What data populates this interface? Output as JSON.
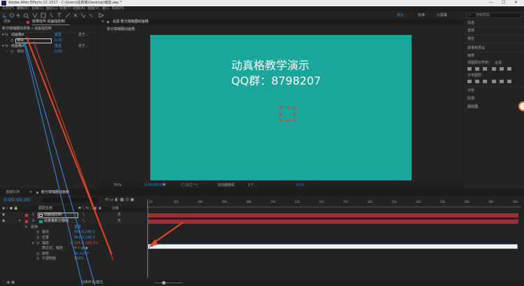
{
  "titlebar": {
    "title": "Adobe After Effects CC 2017 - C:\\Users\\动真格\\Desktop\\缩放.aep *"
  },
  "menu": [
    "文件(F)",
    "编辑(E)",
    "合成(C)",
    "图层(L)",
    "效果(T)",
    "动画(A)",
    "视图(V)",
    "窗口",
    "帮助(H)"
  ],
  "workspaces": [
    "默认",
    "标准",
    "小屏幕"
  ],
  "search_help_placeholder": "搜索帮助",
  "left_panel": {
    "tabs": [
      "项目",
      "效果控件 动画指控制"
    ],
    "breadcrumb": "新分镜缩圈动漫格 • 动画指控制",
    "rows": [
      {
        "name": "动画格A",
        "reset": "重置",
        "about": "关于..."
      },
      {
        "name": "滑块",
        "value": "0.00"
      },
      {
        "name": "动画格A",
        "reset": "重置",
        "about": "关于..."
      },
      {
        "name": "滑块",
        "value": "0.00"
      }
    ]
  },
  "comp_panel": {
    "tab": "合成 新分镜缩圈动画格",
    "sub_tab": "新分镜缩圈动画格",
    "overlay_line1": "动真格教学演示",
    "overlay_line2": "QQ群：8798207",
    "bg_color": "#1aa69a",
    "footer": {
      "zoom": "55%",
      "time": "0:00:00:00",
      "quality": "(二分之一)",
      "view": "活动摄像机",
      "views_count": "1个...",
      "exposure": "+0.0"
    }
  },
  "right_panel": {
    "items": [
      "信息",
      "音频",
      "预览",
      "效果和预设",
      "对齐",
      "字符",
      "段落",
      "跟踪器"
    ],
    "align_label": "将图层对齐到：",
    "align_value": "合成",
    "distribute_label": "分布图层："
  },
  "timeline": {
    "tabs": [
      "渲染队列",
      "新分镜缩圈动画格"
    ],
    "timecode": "0:00:00:00",
    "col_name": "图层名称",
    "col_parent": "父级",
    "ruler": [
      "0s",
      "02s",
      "04s",
      "06s",
      "08s",
      "10s",
      "12s",
      "14s",
      "16s",
      "18s",
      "20s",
      "22s",
      "24s",
      "26s",
      "28s",
      "30s"
    ],
    "layers": [
      {
        "num": "1",
        "name": "动画指控制",
        "parent": "无",
        "color": "#c73b3b"
      },
      {
        "num": "2",
        "name": "动真格新分镜缩",
        "parent": "无",
        "color": "#c73b3b"
      }
    ],
    "transform": "变换",
    "transform_reset": "重置",
    "props": [
      {
        "name": "锚点",
        "value": "960.0,540.0"
      },
      {
        "name": "位置",
        "value": "960.0,540.0"
      },
      {
        "name": "缩放",
        "value": "100.0,100.0%"
      },
      {
        "name": "表达式：缩放",
        "value": ""
      },
      {
        "name": "旋转",
        "value": "0x +0.0°"
      },
      {
        "name": "不透明度",
        "value": "100%"
      }
    ],
    "expression_text": "s=",
    "footer": "切换开关/模式"
  }
}
